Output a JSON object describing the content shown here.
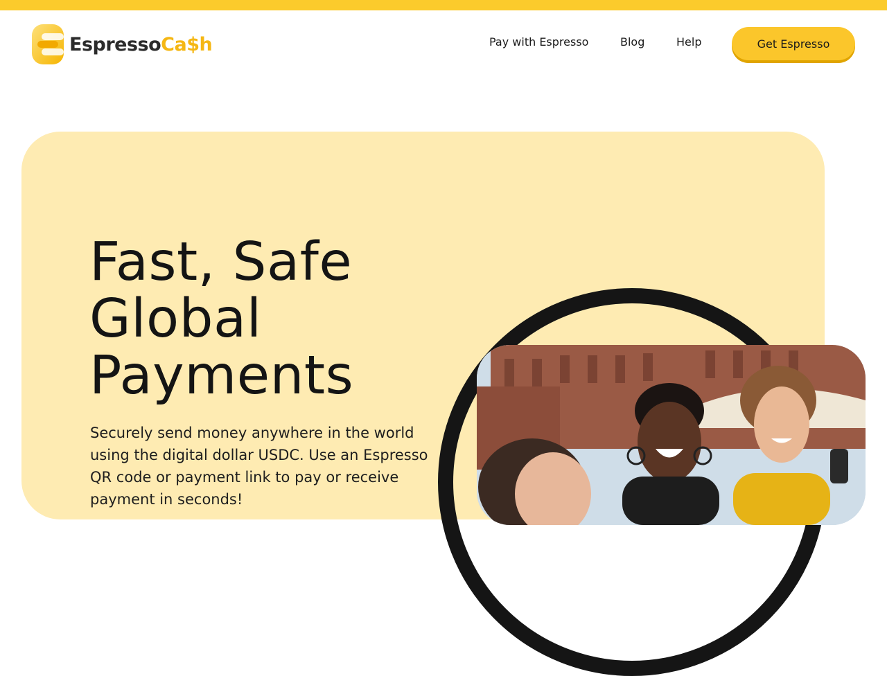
{
  "brand": {
    "name_part1": "Espresso",
    "name_part2": "Ca$h",
    "logo_icon": "espresso-e-logo-icon",
    "colors": {
      "accent": "#fbc62b",
      "hero_bg": "#feebb2",
      "text": "#1a1a1a"
    }
  },
  "nav": {
    "items": [
      {
        "label": "Pay with Espresso"
      },
      {
        "label": "Blog"
      },
      {
        "label": "Help"
      }
    ],
    "cta_label": "Get Espresso"
  },
  "hero": {
    "headline": [
      "Fast, Safe",
      "Global",
      "Payments"
    ],
    "subtext": "Securely send money anywhere in the world using the digital dollar USDC. Use an Espresso QR code or payment link to pay or receive payment in seconds!",
    "image_alt": "Three smiling women at an outdoor market"
  }
}
